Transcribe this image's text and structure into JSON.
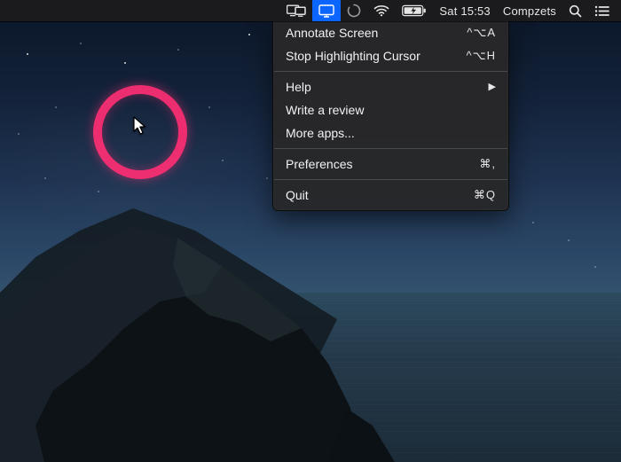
{
  "menubar": {
    "clock": "Sat 15:53",
    "username": "Compzets"
  },
  "dropdown": {
    "items": [
      {
        "label": "Annotate Screen",
        "shortcut": "^⌥A"
      },
      {
        "label": "Stop Highlighting Cursor",
        "shortcut": "^⌥H"
      }
    ],
    "help_label": "Help",
    "review_label": "Write a review",
    "more_apps_label": "More apps...",
    "preferences_label": "Preferences",
    "preferences_shortcut": "⌘,",
    "quit_label": "Quit",
    "quit_shortcut": "⌘Q"
  },
  "highlight": {
    "ring_color": "#ff2e74"
  }
}
